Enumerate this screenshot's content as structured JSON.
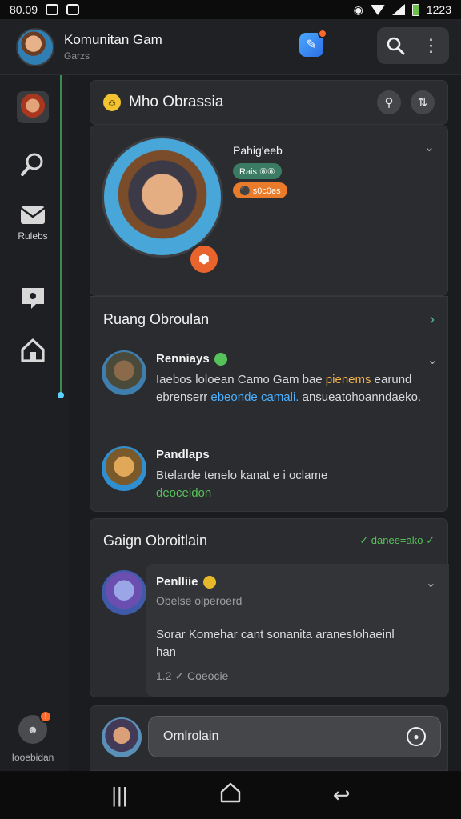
{
  "statusbar": {
    "time": "80.09",
    "battery_time": "1223"
  },
  "appbar": {
    "title": "Komunitan Gam",
    "subtitle": "Garzs"
  },
  "rail": {
    "items": [
      {
        "icon": "profile-avatar"
      },
      {
        "icon": "search-icon"
      },
      {
        "icon": "mail-icon",
        "label": "Rulebs"
      },
      {
        "icon": "chat-icon"
      },
      {
        "icon": "home-icon"
      }
    ],
    "bottom": {
      "label": "Iooebidan"
    }
  },
  "header": {
    "title": "Mho Obrassia",
    "emoji": "☺"
  },
  "profile": {
    "name": "Pahig'eeb",
    "pill_level": "Rais ⑧⑧",
    "pill_badge": "⚫ s0c0es"
  },
  "section": {
    "title": "Ruang Obroulan"
  },
  "messages": [
    {
      "name": "Renniays",
      "text_a": "Iaebos loloean Camo Gam bae ",
      "text_b": "pienems",
      "text_c": " earund ebrenserr ",
      "text_d": "ebeonde camali.",
      "text_e": " ansueatohoanndaeko."
    },
    {
      "name": "Pandlaps",
      "text": "Btelarde tenelo kanat e i oclame",
      "status": "deoceidon"
    }
  ],
  "group": {
    "title": "Gaign Obroitlain",
    "meta": "✓ danee=ako ✓",
    "name": "Penlliie",
    "sub": "Obelse olperoerd",
    "text": "Sorar Komehar cant sonanita aranes!ohaeinl han",
    "foot": "1.2 ✓ Coeocie"
  },
  "composer": {
    "placeholder": "Ornlrolain"
  }
}
